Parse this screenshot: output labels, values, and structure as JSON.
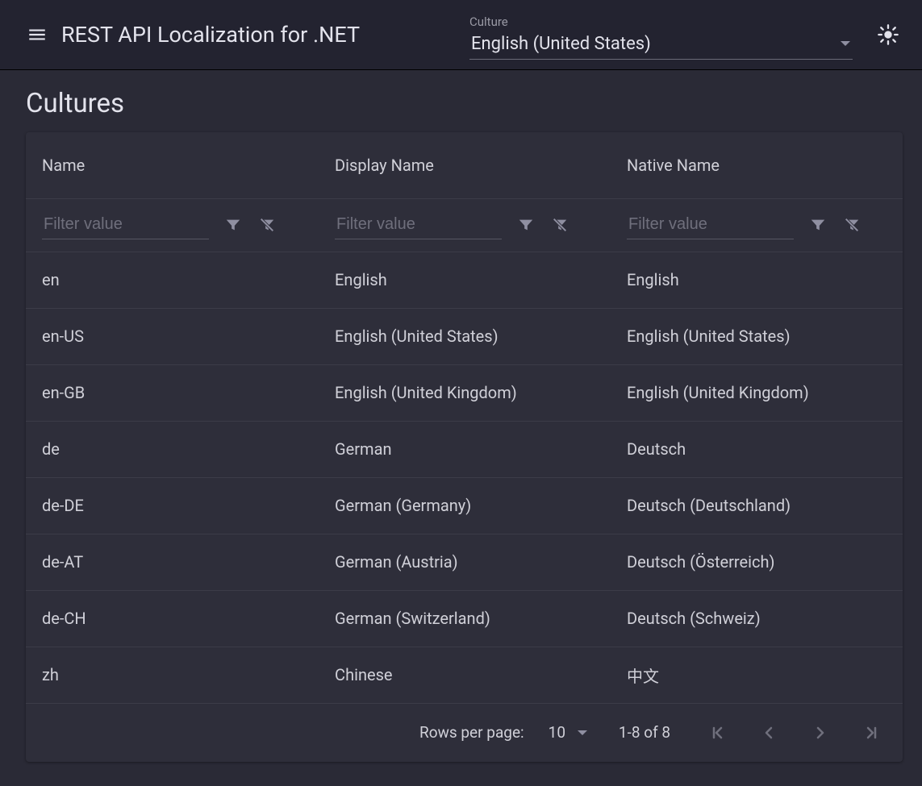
{
  "app": {
    "title": "REST API Localization for .NET"
  },
  "culture_select": {
    "label": "Culture",
    "value": "English (United States)"
  },
  "page": {
    "heading": "Cultures"
  },
  "table": {
    "columns": {
      "name": "Name",
      "display_name": "Display Name",
      "native_name": "Native Name"
    },
    "filter_placeholder": "Filter value",
    "rows": [
      {
        "name": "en",
        "display_name": "English",
        "native_name": "English"
      },
      {
        "name": "en-US",
        "display_name": "English (United States)",
        "native_name": "English (United States)"
      },
      {
        "name": "en-GB",
        "display_name": "English (United Kingdom)",
        "native_name": "English (United Kingdom)"
      },
      {
        "name": "de",
        "display_name": "German",
        "native_name": "Deutsch"
      },
      {
        "name": "de-DE",
        "display_name": "German (Germany)",
        "native_name": "Deutsch (Deutschland)"
      },
      {
        "name": "de-AT",
        "display_name": "German (Austria)",
        "native_name": "Deutsch (Österreich)"
      },
      {
        "name": "de-CH",
        "display_name": "German (Switzerland)",
        "native_name": "Deutsch (Schweiz)"
      },
      {
        "name": "zh",
        "display_name": "Chinese",
        "native_name": "中文"
      }
    ],
    "pagination": {
      "rows_per_page_label": "Rows per page:",
      "rows_per_page_value": "10",
      "range_label": "1-8 of 8"
    }
  }
}
